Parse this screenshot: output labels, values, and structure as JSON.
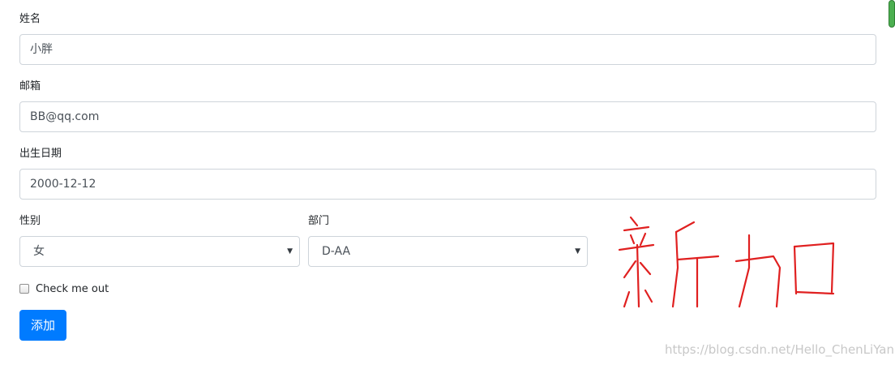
{
  "form": {
    "name": {
      "label": "姓名",
      "value": "小胖"
    },
    "email": {
      "label": "邮箱",
      "value": "BB@qq.com"
    },
    "birth": {
      "label": "出生日期",
      "value": "2000-12-12"
    },
    "gender": {
      "label": "性别",
      "selected": "女"
    },
    "department": {
      "label": "部门",
      "selected": "D-AA"
    },
    "check_label": "Check me out",
    "submit_label": "添加"
  },
  "annotation": {
    "text": "新加",
    "color": "#e02020"
  },
  "watermark": "https://blog.csdn.net/Hello_ChenLiYan",
  "colors": {
    "accent": "#007bff",
    "border": "#ced4da",
    "scrollbar": "#4caf50"
  }
}
